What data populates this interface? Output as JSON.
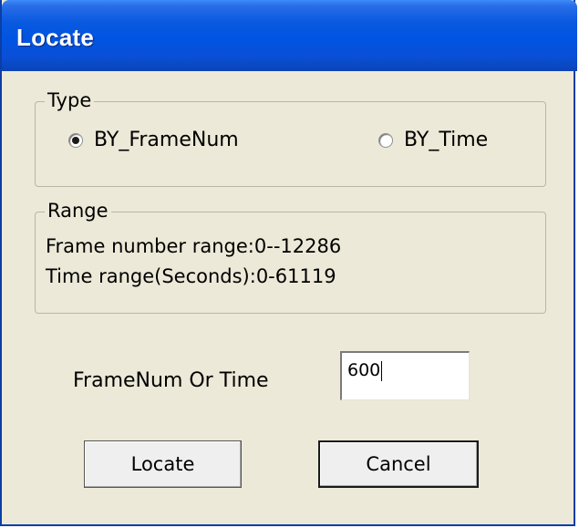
{
  "window": {
    "title": "Locate"
  },
  "type_group": {
    "legend": "Type",
    "options": [
      {
        "label": "BY_FrameNum",
        "selected": true
      },
      {
        "label": "BY_Time",
        "selected": false
      }
    ]
  },
  "range_group": {
    "legend": "Range",
    "lines": [
      "Frame number range:0--12286",
      "Time range(Seconds):0-61119"
    ]
  },
  "input": {
    "label": "FrameNum Or Time",
    "value": "600"
  },
  "buttons": {
    "locate": "Locate",
    "cancel": "Cancel"
  },
  "colors": {
    "titlebar": "#0054e3",
    "dialog_bg": "#ece9d8"
  }
}
